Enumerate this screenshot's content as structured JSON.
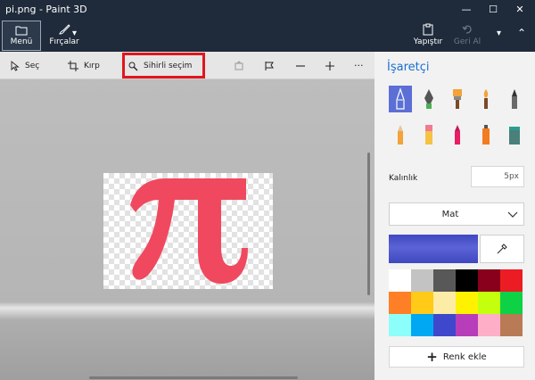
{
  "window": {
    "title": "pi.png - Paint 3D",
    "minimize": "—",
    "maximize": "☐",
    "close": "✕"
  },
  "ribbon": {
    "menu_label": "Menü",
    "brushes_label": "Fırçalar",
    "paste_label": "Yapıştır",
    "undo_label": "Geri Al"
  },
  "toolbar": {
    "select_label": "Seç",
    "crop_label": "Kırp",
    "magic_select_label": "Sihirli seçim",
    "more": "···"
  },
  "canvas": {
    "glyph": "π",
    "glyph_color": "#f0495f"
  },
  "panel": {
    "title": "İşaretçi",
    "thickness_label": "Kalınlık",
    "thickness_value": "5px",
    "finish_value": "Mat",
    "current_color": "#4048c0",
    "add_color_label": "Renk ekle",
    "brushes": [
      "marker-icon",
      "calligraphy-pen-icon",
      "oil-brush-icon",
      "watercolor-icon",
      "pixel-pen-icon",
      "pencil-icon",
      "eraser-icon",
      "crayon-icon",
      "spray-can-icon",
      "fill-bucket-icon"
    ],
    "palette": [
      "#ffffff",
      "#c3c3c3",
      "#585858",
      "#000000",
      "#88001b",
      "#ec1c24",
      "#ff7f27",
      "#ffca18",
      "#fdeca6",
      "#fff200",
      "#c4ff0e",
      "#0ed145",
      "#8cfffb",
      "#00a8f3",
      "#3f48cc",
      "#b83dba",
      "#ffaec8",
      "#b97a56"
    ]
  },
  "colors": {
    "titlebar": "#1f2b3b",
    "accent": "#1b6fd1",
    "highlight": "#e1161d"
  }
}
